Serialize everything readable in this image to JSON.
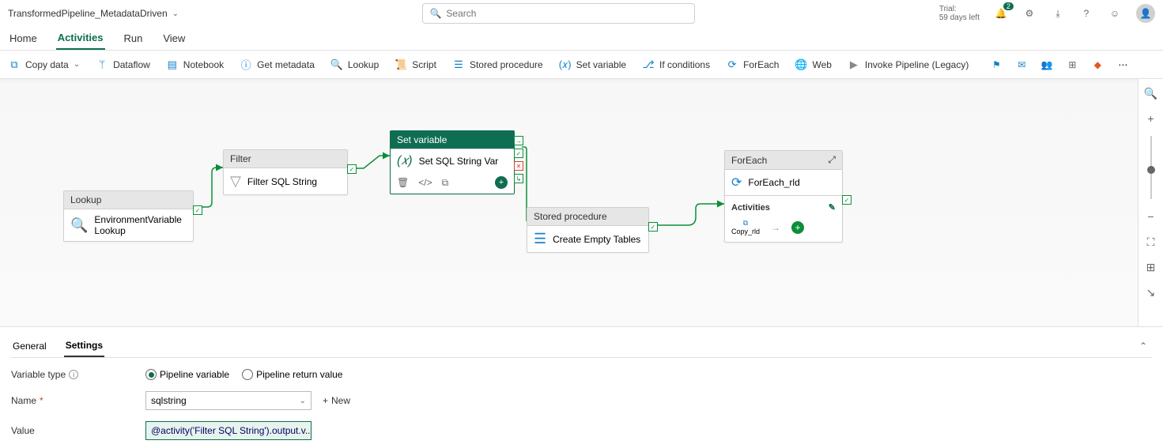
{
  "header": {
    "title": "TransformedPipeline_MetadataDriven",
    "search_placeholder": "Search",
    "trial_line1": "Trial:",
    "trial_line2": "59 days left",
    "notif_count": "2"
  },
  "nav": {
    "home": "Home",
    "activities": "Activities",
    "run": "Run",
    "view": "View"
  },
  "toolbar": {
    "copy_data": "Copy data",
    "dataflow": "Dataflow",
    "notebook": "Notebook",
    "get_metadata": "Get metadata",
    "lookup": "Lookup",
    "script": "Script",
    "stored_proc": "Stored procedure",
    "set_variable": "Set variable",
    "if_cond": "If conditions",
    "foreach": "ForEach",
    "web": "Web",
    "invoke": "Invoke Pipeline (Legacy)"
  },
  "nodes": {
    "lookup": {
      "type": "Lookup",
      "name": "EnvironmentVariableLookup"
    },
    "filter": {
      "type": "Filter",
      "name": "Filter SQL String"
    },
    "setvar": {
      "type": "Set variable",
      "name": "Set SQL String Var"
    },
    "sp": {
      "type": "Stored procedure",
      "name": "Create Empty Tables"
    },
    "foreach": {
      "type": "ForEach",
      "name": "ForEach_rld",
      "inner_label": "Activities",
      "inner_act": "Copy_rld"
    }
  },
  "panel": {
    "tab_general": "General",
    "tab_settings": "Settings",
    "var_type_label": "Variable type",
    "radio_pipe": "Pipeline variable",
    "radio_return": "Pipeline return value",
    "name_label": "Name",
    "name_value": "sqlstring",
    "value_label": "Value",
    "value_expr": "@activity('Filter SQL String').output.v...",
    "new_btn": "New"
  }
}
